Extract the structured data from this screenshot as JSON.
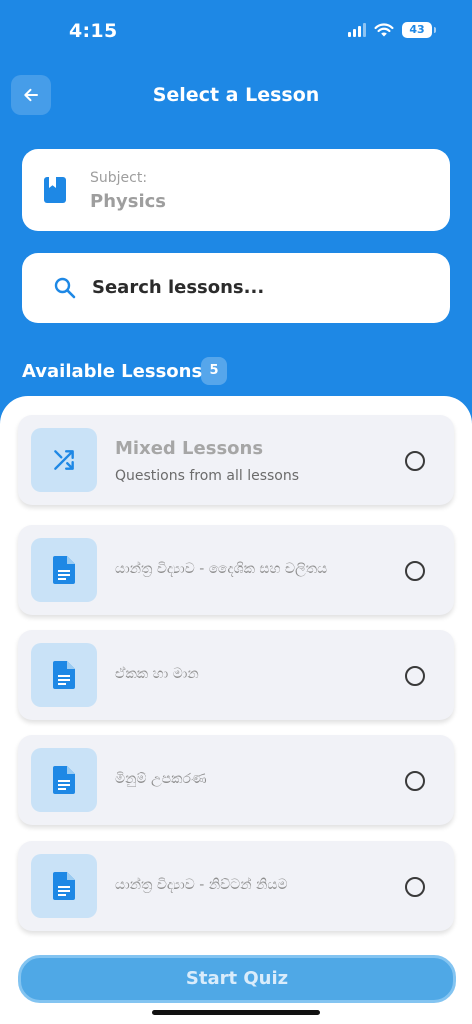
{
  "status_bar": {
    "time": "4:15",
    "battery": "43"
  },
  "header": {
    "title": "Select a Lesson"
  },
  "subject": {
    "label": "Subject:",
    "value": "Physics"
  },
  "search": {
    "placeholder": "Search lessons..."
  },
  "section": {
    "title": "Available Lessons",
    "count": "5"
  },
  "lessons": [
    {
      "title": "Mixed Lessons",
      "subtitle": "Questions from all lessons",
      "icon": "shuffle-icon"
    },
    {
      "title": "යාන්ත්‍ර විද්‍යාව - දෛශික සහ චලිතය",
      "icon": "document-icon"
    },
    {
      "title": "ඒකක හා මාන",
      "icon": "document-icon"
    },
    {
      "title": "මිනුම් උපකරණ",
      "icon": "document-icon"
    },
    {
      "title": "යාන්ත්‍ර විද්‍යාව - නිව්ටන් නියම",
      "icon": "document-icon"
    }
  ],
  "actions": {
    "start_label": "Start Quiz"
  },
  "colors": {
    "primary": "#1e88e5",
    "icon_bg": "#c9e2f7",
    "card_bg": "#f1f2f7"
  }
}
